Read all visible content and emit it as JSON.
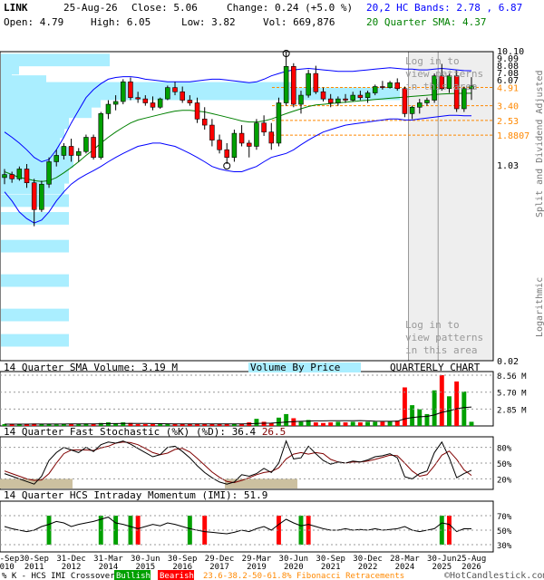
{
  "header": {
    "symbol": "LINK",
    "date": "25-Aug-26",
    "close": "Close: 5.06",
    "change": "Change: 0.24 (+5.0 %)",
    "open": "Open: 4.79",
    "high": "High: 6.05",
    "low": "Low: 3.82",
    "vol": "Vol: 669,876",
    "bands": "20,2 HC Bands: 2.78 , 6.87",
    "sma": "20 Quarter SMA: 4.37"
  },
  "colors": {
    "bull": "#00a000",
    "bear": "#ff0000",
    "upper_band": "#0000ff",
    "sma": "#008000",
    "vbp": "#aaeeff",
    "fib": "#ff8800",
    "signal": "#800000"
  },
  "price_axis": {
    "labels": [
      "10.10",
      "9.09",
      "8.08",
      "7.08",
      "6.07",
      "4.91",
      "3.40",
      "2.53",
      "1.8807",
      "1.03",
      "0.02"
    ],
    "side_label_top": "Split and Dividend Adjusted",
    "side_label_bottom": "Logarithmic"
  },
  "watermark": {
    "top": [
      "Log in to",
      "view patterns",
      "in this area"
    ],
    "bottom": [
      "Log in to",
      "view patterns",
      "in this area"
    ]
  },
  "volume_panel": {
    "title": "14 Quarter SMA Volume: 3.19 M",
    "center": "Volume By Price",
    "right": "QUARTERLY CHART",
    "axis": [
      "8.56 M",
      "5.70 M",
      "2.85 M"
    ]
  },
  "stoch_panel": {
    "title": "14 Quarter Fast Stochastic (%K)",
    "value_k": "36.4",
    "value_d": "26.5",
    "d_label": "(%D):",
    "axis": [
      "80%",
      "50%",
      "20%"
    ]
  },
  "imi_panel": {
    "title": "14 Quarter HCS Intraday Momentum (IMI): 51.9",
    "axis": [
      "70%",
      "50%",
      "30%"
    ]
  },
  "x_axis": [
    {
      "top": "30-Sep",
      "bottom": "2010"
    },
    {
      "top": "30-Sep",
      "bottom": "2011"
    },
    {
      "top": "31-Dec",
      "bottom": "2012"
    },
    {
      "top": "31-Mar",
      "bottom": "2014"
    },
    {
      "top": "30-Jun",
      "bottom": "2015"
    },
    {
      "top": "30-Sep",
      "bottom": "2016"
    },
    {
      "top": "29-Dec",
      "bottom": "2017"
    },
    {
      "top": "29-Mar",
      "bottom": "2019"
    },
    {
      "top": "30-Jun",
      "bottom": "2020"
    },
    {
      "top": "30-Sep",
      "bottom": "2021"
    },
    {
      "top": "30-Dec",
      "bottom": "2022"
    },
    {
      "top": "28-Mar",
      "bottom": "2024"
    },
    {
      "top": "30-Jun",
      "bottom": "2025"
    },
    {
      "top": "25-Aug",
      "bottom": "2026"
    }
  ],
  "footer": {
    "left": "% K - HCS IMI Crossover:",
    "bullish": "Bullish",
    "bearish": "Bearish",
    "fib": "23.6-38.2-50-61.8% Fibonacci Retracements",
    "brand": "©HotCandlestick.com"
  },
  "chart_data": {
    "type": "candlestick",
    "scale": "log",
    "ylim": [
      0.02,
      10.1
    ],
    "fib_levels": [
      4.91,
      3.4,
      2.53,
      1.8807
    ],
    "candles": [
      [
        0.8,
        0.95,
        0.7,
        0.85
      ],
      [
        0.85,
        0.9,
        0.72,
        0.78
      ],
      [
        0.78,
        1.0,
        0.75,
        0.95
      ],
      [
        0.95,
        1.05,
        0.65,
        0.72
      ],
      [
        0.72,
        0.78,
        0.3,
        0.42
      ],
      [
        0.42,
        0.75,
        0.4,
        0.7
      ],
      [
        0.7,
        1.2,
        0.65,
        1.1
      ],
      [
        1.1,
        1.4,
        1.0,
        1.25
      ],
      [
        1.25,
        1.6,
        1.15,
        1.5
      ],
      [
        1.5,
        1.75,
        1.1,
        1.25
      ],
      [
        1.25,
        1.45,
        1.1,
        1.35
      ],
      [
        1.35,
        1.9,
        1.3,
        1.8
      ],
      [
        1.8,
        1.9,
        1.15,
        1.2
      ],
      [
        1.2,
        3.0,
        1.15,
        2.9
      ],
      [
        2.9,
        3.8,
        2.6,
        3.5
      ],
      [
        3.5,
        4.2,
        3.1,
        3.7
      ],
      [
        3.7,
        5.8,
        3.5,
        5.5
      ],
      [
        5.5,
        6.0,
        3.8,
        4.0
      ],
      [
        4.0,
        4.5,
        3.6,
        3.9
      ],
      [
        3.9,
        4.2,
        3.4,
        3.6
      ],
      [
        3.6,
        4.1,
        3.1,
        3.3
      ],
      [
        3.3,
        4.0,
        3.2,
        3.9
      ],
      [
        3.9,
        5.1,
        3.8,
        4.9
      ],
      [
        4.9,
        5.5,
        4.2,
        4.5
      ],
      [
        4.5,
        5.0,
        3.6,
        3.8
      ],
      [
        3.8,
        4.2,
        3.4,
        3.6
      ],
      [
        3.6,
        4.0,
        2.4,
        2.6
      ],
      [
        2.6,
        3.3,
        2.1,
        2.3
      ],
      [
        2.3,
        2.6,
        1.5,
        1.7
      ],
      [
        1.7,
        1.9,
        1.3,
        1.4
      ],
      [
        1.4,
        1.6,
        1.05,
        1.2
      ],
      [
        1.2,
        2.1,
        1.1,
        1.95
      ],
      [
        1.95,
        2.3,
        1.5,
        1.6
      ],
      [
        1.6,
        1.7,
        1.2,
        1.5
      ],
      [
        1.5,
        2.6,
        1.4,
        2.4
      ],
      [
        2.4,
        2.8,
        1.85,
        2.0
      ],
      [
        2.0,
        2.4,
        1.4,
        1.6
      ],
      [
        1.6,
        4.0,
        1.5,
        3.6
      ],
      [
        3.6,
        10.1,
        3.4,
        7.5
      ],
      [
        7.5,
        8.0,
        3.3,
        3.5
      ],
      [
        3.5,
        4.6,
        2.9,
        4.2
      ],
      [
        4.2,
        7.0,
        4.0,
        6.5
      ],
      [
        6.5,
        7.6,
        4.3,
        4.5
      ],
      [
        4.5,
        4.9,
        3.7,
        3.9
      ],
      [
        3.9,
        4.3,
        3.3,
        3.6
      ],
      [
        3.6,
        4.1,
        3.4,
        3.9
      ],
      [
        3.9,
        4.3,
        3.6,
        3.8
      ],
      [
        3.8,
        4.5,
        3.7,
        4.2
      ],
      [
        4.2,
        4.6,
        3.8,
        4.0
      ],
      [
        4.0,
        4.6,
        3.6,
        4.4
      ],
      [
        4.4,
        5.2,
        4.2,
        5.0
      ],
      [
        5.0,
        5.6,
        4.7,
        4.9
      ],
      [
        4.9,
        5.6,
        4.8,
        5.4
      ],
      [
        5.4,
        5.9,
        4.6,
        4.8
      ],
      [
        4.8,
        5.0,
        2.7,
        2.9
      ],
      [
        2.9,
        3.4,
        2.6,
        3.3
      ],
      [
        3.3,
        3.9,
        2.9,
        3.6
      ],
      [
        3.6,
        4.0,
        3.4,
        3.8
      ],
      [
        3.8,
        6.5,
        3.6,
        6.2
      ],
      [
        6.2,
        7.9,
        4.6,
        4.8
      ],
      [
        4.8,
        6.5,
        4.4,
        6.2
      ],
      [
        6.2,
        6.9,
        3.0,
        3.2
      ],
      [
        3.2,
        5.0,
        3.0,
        4.8
      ],
      [
        4.79,
        6.05,
        3.82,
        5.06
      ]
    ],
    "bb_upper": [
      2.0,
      1.8,
      1.6,
      1.4,
      1.2,
      1.1,
      1.15,
      1.4,
      1.8,
      2.4,
      3.1,
      4.0,
      4.7,
      5.3,
      5.8,
      6.0,
      6.1,
      6.1,
      6.0,
      5.8,
      5.7,
      5.6,
      5.5,
      5.5,
      5.5,
      5.5,
      5.6,
      5.7,
      5.8,
      5.8,
      5.7,
      5.6,
      5.5,
      5.4,
      5.5,
      5.8,
      6.2,
      6.5,
      6.8,
      7.0,
      7.1,
      7.2,
      7.1,
      7.0,
      6.9,
      6.8,
      6.8,
      6.8,
      6.9,
      7.0,
      7.1,
      7.2,
      7.3,
      7.2,
      7.1,
      7.1,
      7.0,
      7.0,
      7.1,
      7.2,
      7.1,
      7.0,
      6.9,
      6.87
    ],
    "bb_lower": [
      0.6,
      0.5,
      0.4,
      0.35,
      0.32,
      0.34,
      0.4,
      0.5,
      0.6,
      0.7,
      0.78,
      0.85,
      0.92,
      1.0,
      1.1,
      1.2,
      1.3,
      1.4,
      1.5,
      1.55,
      1.6,
      1.6,
      1.55,
      1.5,
      1.4,
      1.3,
      1.2,
      1.1,
      1.0,
      0.95,
      0.92,
      0.9,
      0.9,
      0.95,
      1.0,
      1.1,
      1.2,
      1.25,
      1.3,
      1.4,
      1.55,
      1.7,
      1.85,
      2.0,
      2.1,
      2.2,
      2.3,
      2.35,
      2.4,
      2.45,
      2.5,
      2.55,
      2.6,
      2.6,
      2.55,
      2.55,
      2.6,
      2.65,
      2.7,
      2.75,
      2.8,
      2.8,
      2.78,
      2.78
    ],
    "sma": [
      0.9,
      0.85,
      0.8,
      0.78,
      0.75,
      0.74,
      0.75,
      0.8,
      0.88,
      0.98,
      1.1,
      1.25,
      1.4,
      1.6,
      1.8,
      2.0,
      2.2,
      2.4,
      2.55,
      2.65,
      2.75,
      2.85,
      2.95,
      3.05,
      3.1,
      3.1,
      3.05,
      3.0,
      2.9,
      2.8,
      2.7,
      2.6,
      2.5,
      2.45,
      2.45,
      2.5,
      2.6,
      2.75,
      2.9,
      3.05,
      3.2,
      3.35,
      3.45,
      3.5,
      3.55,
      3.6,
      3.65,
      3.7,
      3.75,
      3.8,
      3.85,
      3.9,
      3.95,
      4.0,
      4.05,
      4.1,
      4.15,
      4.2,
      4.25,
      4.3,
      4.33,
      4.35,
      4.36,
      4.37
    ],
    "volume": [
      0.3,
      0.3,
      0.25,
      0.3,
      0.4,
      0.3,
      0.3,
      0.25,
      0.3,
      0.35,
      0.3,
      0.4,
      0.35,
      0.5,
      0.6,
      0.4,
      0.6,
      0.5,
      0.3,
      0.3,
      0.3,
      0.3,
      0.3,
      0.3,
      0.3,
      0.3,
      0.3,
      0.3,
      0.3,
      0.3,
      0.3,
      0.3,
      0.3,
      0.6,
      1.2,
      0.7,
      0.5,
      1.4,
      2.0,
      1.3,
      0.7,
      1.0,
      0.6,
      0.5,
      0.6,
      0.7,
      0.6,
      0.7,
      0.6,
      0.7,
      0.7,
      0.7,
      0.8,
      0.9,
      6.5,
      3.5,
      2.8,
      2.0,
      6.0,
      8.56,
      5.0,
      7.5,
      5.8,
      0.7
    ],
    "volume_sma": [
      0.3,
      0.3,
      0.3,
      0.3,
      0.32,
      0.32,
      0.32,
      0.32,
      0.32,
      0.33,
      0.33,
      0.34,
      0.35,
      0.37,
      0.39,
      0.4,
      0.42,
      0.43,
      0.43,
      0.42,
      0.4,
      0.38,
      0.36,
      0.35,
      0.34,
      0.33,
      0.33,
      0.33,
      0.33,
      0.33,
      0.33,
      0.33,
      0.34,
      0.37,
      0.42,
      0.46,
      0.48,
      0.55,
      0.66,
      0.74,
      0.78,
      0.83,
      0.85,
      0.86,
      0.87,
      0.88,
      0.88,
      0.89,
      0.9,
      0.85,
      0.8,
      0.78,
      0.78,
      0.8,
      1.2,
      1.4,
      1.55,
      1.6,
      1.85,
      2.3,
      2.55,
      2.9,
      3.1,
      3.19
    ],
    "stoch_k": [
      30,
      25,
      20,
      15,
      10,
      25,
      55,
      70,
      80,
      75,
      70,
      80,
      72,
      85,
      90,
      88,
      92,
      86,
      78,
      70,
      62,
      66,
      80,
      82,
      72,
      60,
      45,
      32,
      22,
      14,
      10,
      14,
      28,
      25,
      30,
      40,
      32,
      50,
      92,
      58,
      60,
      82,
      68,
      55,
      48,
      52,
      50,
      54,
      52,
      56,
      62,
      64,
      68,
      60,
      24,
      20,
      30,
      35,
      70,
      90,
      60,
      22,
      30,
      36.4
    ],
    "stoch_d": [
      35,
      30,
      25,
      20,
      17,
      18,
      30,
      50,
      68,
      75,
      75,
      75,
      74,
      79,
      82,
      88,
      90,
      89,
      85,
      78,
      70,
      66,
      69,
      76,
      78,
      71,
      59,
      46,
      33,
      23,
      15,
      13,
      17,
      22,
      28,
      32,
      34,
      41,
      58,
      67,
      70,
      67,
      70,
      68,
      57,
      52,
      50,
      52,
      52,
      54,
      57,
      61,
      65,
      64,
      50,
      35,
      25,
      28,
      45,
      65,
      73,
      57,
      37,
      26.5
    ],
    "imi": [
      55,
      52,
      50,
      48,
      50,
      55,
      58,
      62,
      60,
      55,
      58,
      60,
      62,
      65,
      68,
      60,
      58,
      55,
      52,
      55,
      58,
      56,
      60,
      58,
      55,
      52,
      50,
      48,
      47,
      46,
      45,
      47,
      50,
      48,
      52,
      55,
      50,
      58,
      65,
      60,
      56,
      58,
      55,
      52,
      50,
      50,
      52,
      50,
      51,
      50,
      52,
      50,
      51,
      52,
      55,
      50,
      48,
      50,
      52,
      60,
      58,
      48,
      52,
      51.9
    ],
    "imi_bars": [
      [
        6,
        "bull"
      ],
      [
        13,
        "bull"
      ],
      [
        15,
        "bull"
      ],
      [
        17,
        "bull"
      ],
      [
        18,
        "bear"
      ],
      [
        25,
        "bull"
      ],
      [
        27,
        "bear"
      ],
      [
        37,
        "bear"
      ],
      [
        40,
        "bull"
      ],
      [
        41,
        "bear"
      ],
      [
        59,
        "bull"
      ],
      [
        60,
        "bear"
      ]
    ]
  }
}
